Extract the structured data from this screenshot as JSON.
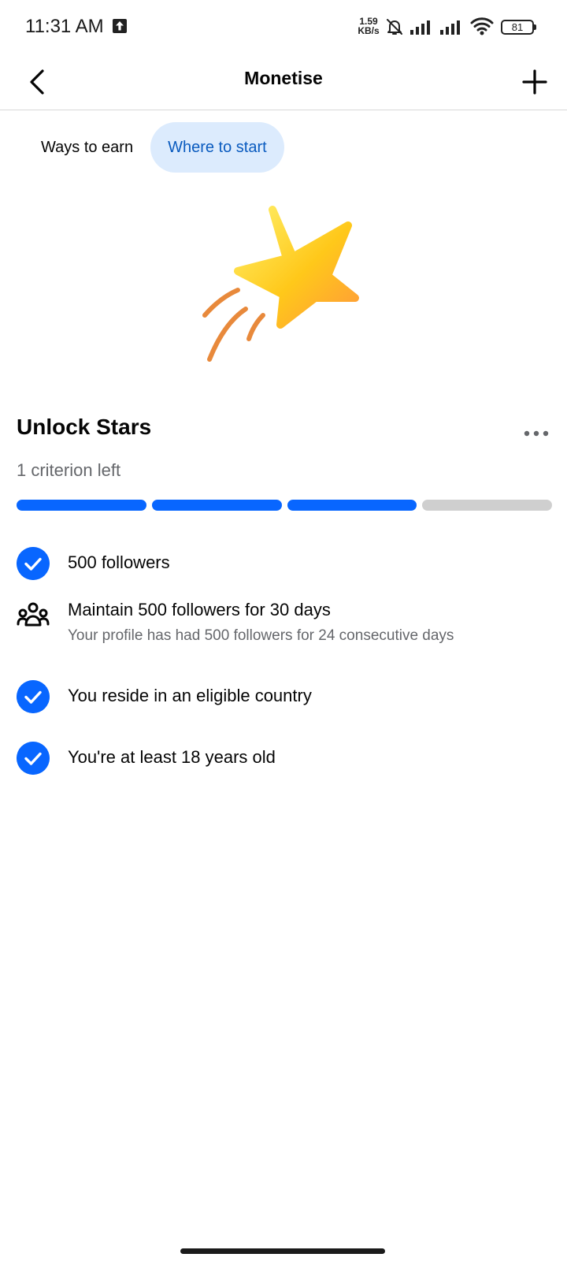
{
  "status_bar": {
    "time": "11:31 AM",
    "net_speed_value": "1.59",
    "net_speed_unit": "KB/s",
    "battery": "81",
    "icons": [
      "upload-icon",
      "mute-icon",
      "signal-icon",
      "signal-icon",
      "wifi-icon",
      "battery-icon"
    ]
  },
  "header": {
    "title": "Monetise",
    "back_icon": "chevron-left-icon",
    "add_icon": "plus-icon"
  },
  "tabs": [
    {
      "label": "Ways to earn",
      "active": false
    },
    {
      "label": "Where to start",
      "active": true
    }
  ],
  "illustration": {
    "icon": "shooting-star-icon"
  },
  "section": {
    "title": "Unlock Stars",
    "subtitle": "1 criterion left",
    "more_icon": "more-horizontal-icon",
    "progress": {
      "completed": 3,
      "total": 4
    }
  },
  "criteria": [
    {
      "title": "500 followers",
      "subtitle": "",
      "icon": "check-circle-icon",
      "completed": true
    },
    {
      "title": "Maintain 500 followers for 30 days",
      "subtitle": "Your profile has had 500 followers for 24 consecutive days",
      "icon": "people-icon",
      "completed": false
    },
    {
      "title": "You reside in an eligible country",
      "subtitle": "",
      "icon": "check-circle-icon",
      "completed": true
    },
    {
      "title": "You're at least 18 years old",
      "subtitle": "",
      "icon": "check-circle-icon",
      "completed": true
    }
  ],
  "colors": {
    "accent": "#0866ff",
    "tab_active_bg": "#dcebfd",
    "tab_active_text": "#0a5bbf",
    "progress_incomplete": "#cfcfcf",
    "secondary_text": "#65676b"
  }
}
